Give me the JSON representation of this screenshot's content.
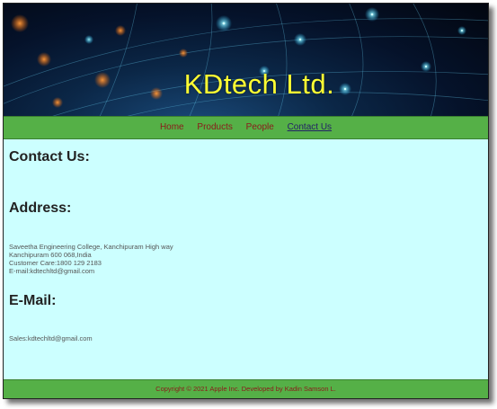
{
  "banner": {
    "title": "KDtech Ltd."
  },
  "nav": {
    "items": [
      {
        "label": "Home"
      },
      {
        "label": "Products"
      },
      {
        "label": "People"
      },
      {
        "label": "Contact Us"
      }
    ]
  },
  "contact": {
    "heading": "Contact Us:",
    "address_heading": "Address:",
    "address_lines": [
      "Saveetha Engineering College, Kanchipuram High way",
      "Kanchipuram 600 068,India",
      "Customer Care:1800 129 2183",
      "E-mail:kdtechltd@gmail.com"
    ],
    "email_heading": "E-Mail:",
    "email_line": "Sales:kdtechltd@gmail.com"
  },
  "footer": {
    "text": "Copyright © 2021 Apple Inc. Developed by Kadin Samson L."
  },
  "colors": {
    "bar_green": "#55b047",
    "content_bg": "#ccffff",
    "title_yellow": "#ffff33",
    "link_red": "#8b1a1a"
  }
}
